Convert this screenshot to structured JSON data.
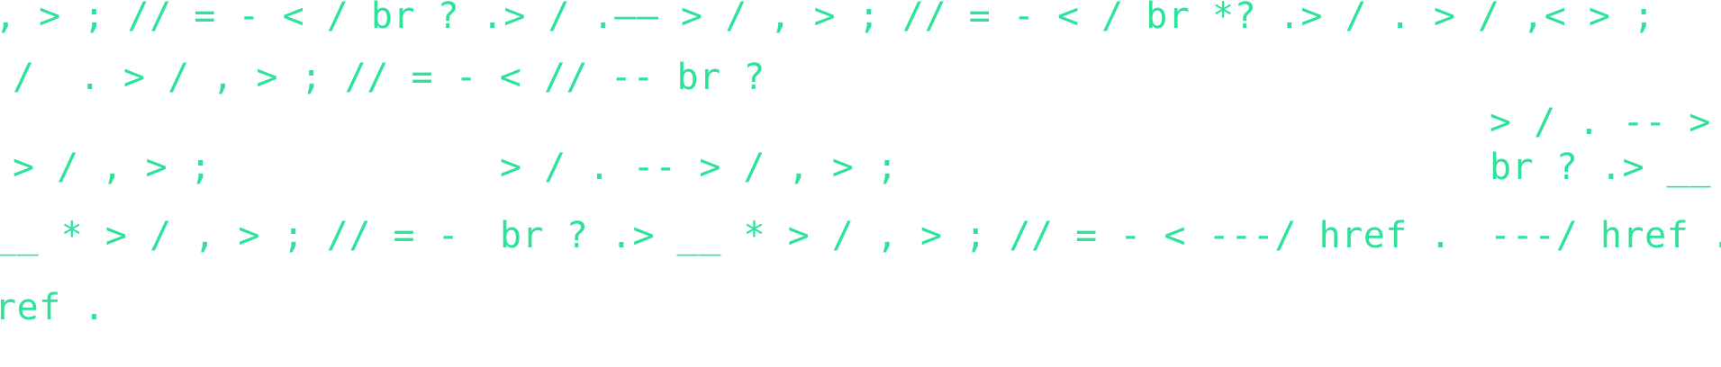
{
  "colors": {
    "background": "#ffffff",
    "text": "#2de39a"
  },
  "lines": [
    ", > ; // = - < / br ? .> / .—— > / , > ; // = - < / br *? .> / . > / ,< > ;",
    "/  . > / , > ; // = - < // -- br ?",
    "> / . -- >",
    "> / , > ;",
    "> / . -- > / , > ;",
    "br ? .> __",
    "__ * > / , > ; // = -",
    "br ? .> __ * > / , > ; // = - < ---/ href .",
    "---/ href .",
    "ref ."
  ]
}
